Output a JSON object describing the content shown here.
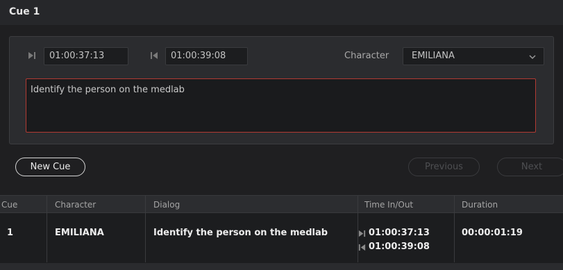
{
  "header": {
    "title": "Cue 1"
  },
  "cue_editor": {
    "time_in": "01:00:37:13",
    "time_out": "01:00:39:08",
    "time_in_icon": "mark-in-icon",
    "time_out_icon": "mark-out-icon",
    "character_label": "Character",
    "character_value": "EMILIANA",
    "dialog_text": "Identify the person on the medlab"
  },
  "actions": {
    "new_cue": "New Cue",
    "previous": "Previous",
    "next": "Next"
  },
  "table": {
    "columns": [
      "Cue",
      "Character",
      "Dialog",
      "Time In/Out",
      "Duration"
    ],
    "rows": [
      {
        "cue": "1",
        "character": "EMILIANA",
        "dialog": "Identify the person on the medlab",
        "time_in": "01:00:37:13",
        "time_out": "01:00:39:08",
        "duration": "00:00:01:19"
      }
    ]
  },
  "colors": {
    "accent_border": "#b23a33",
    "background": "#1f1f21"
  }
}
